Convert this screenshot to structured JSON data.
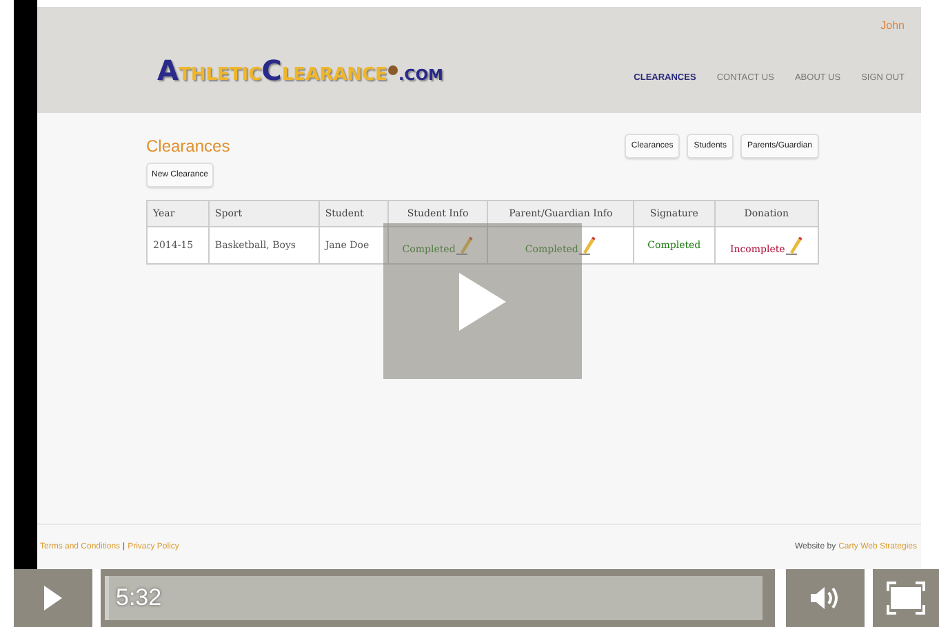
{
  "header": {
    "user": "John",
    "logo": {
      "first": "ATHLETIC",
      "second": "CLEARANCE",
      "tld": ".COM"
    },
    "nav": [
      {
        "label": "CLEARANCES",
        "selected": true
      },
      {
        "label": "CONTACT US",
        "selected": false
      },
      {
        "label": "ABOUT US",
        "selected": false
      },
      {
        "label": "SIGN OUT",
        "selected": false
      }
    ]
  },
  "content": {
    "title": "Clearances",
    "tabs": [
      "Clearances",
      "Students",
      "Parents/Guardian"
    ],
    "new_button": "New Clearance",
    "table": {
      "columns": [
        "Year",
        "Sport",
        "Student",
        "Student Info",
        "Parent/Guardian Info",
        "Signature",
        "Donation"
      ],
      "rows": [
        [
          {
            "text": "2014-15",
            "kind": "plain"
          },
          {
            "text": "Basketball, Boys",
            "kind": "plain"
          },
          {
            "text": "Jane Doe",
            "kind": "plain"
          },
          {
            "text": "Completed",
            "kind": "status",
            "complete": true,
            "editable": true
          },
          {
            "text": "Completed",
            "kind": "status",
            "complete": true,
            "editable": true
          },
          {
            "text": "Completed",
            "kind": "status",
            "complete": true,
            "editable": false
          },
          {
            "text": "Incomplete",
            "kind": "status",
            "complete": false,
            "editable": true
          }
        ]
      ]
    }
  },
  "footer": {
    "links": [
      "Terms and Conditions",
      "Privacy Policy"
    ],
    "separator": "|",
    "credit": "Website by",
    "credit_link": "Carty Web Strategies"
  },
  "player": {
    "time": "5:32"
  }
}
